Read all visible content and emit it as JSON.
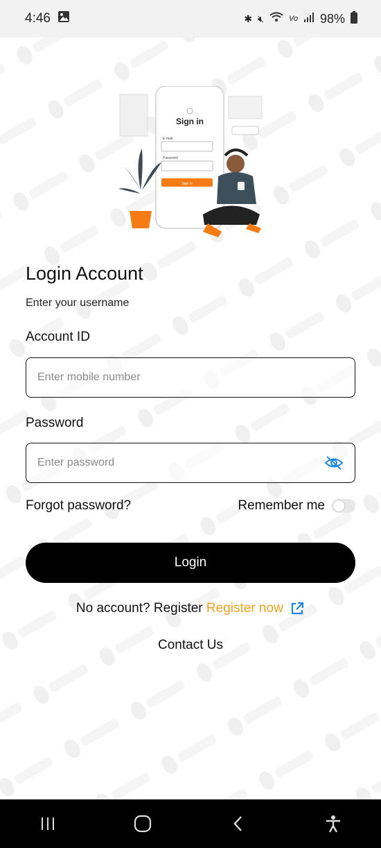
{
  "status_bar": {
    "time": "4:46",
    "battery": "98%",
    "icons": [
      "image-icon",
      "bluetooth-icon",
      "mute-icon",
      "wifi-icon",
      "volte-icon",
      "signal-icon",
      "battery-icon"
    ]
  },
  "illustration": {
    "phone_heading": "Sign in",
    "email_label": "E-mail",
    "password_label": "Password",
    "button_label": "Sign in"
  },
  "login": {
    "title": "Login Account",
    "subtitle": "Enter your username",
    "account_label": "Account ID",
    "account_placeholder": "Enter mobile number",
    "password_label": "Password",
    "password_placeholder": "Enter password",
    "forgot_label": "Forgot password?",
    "remember_label": "Remember me",
    "remember_checked": false,
    "login_button": "Login",
    "no_account_text": "No account? Register",
    "register_link": "Register now",
    "contact_label": "Contact Us"
  },
  "colors": {
    "accent": "#f59f1a",
    "link_icon": "#1e88e5",
    "button_bg": "#000000"
  },
  "nav_bar": {
    "icons": [
      "recents-icon",
      "home-icon",
      "back-icon",
      "accessibility-icon"
    ]
  }
}
